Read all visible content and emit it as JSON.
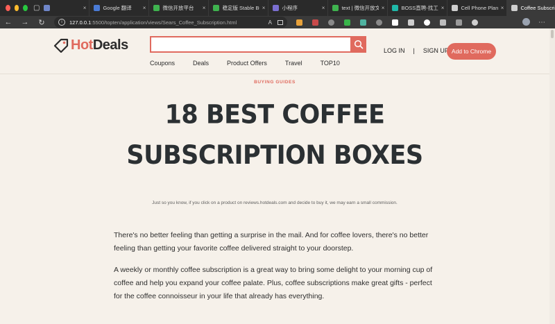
{
  "browser": {
    "tabs": [
      {
        "label": "",
        "color": "#6f86c9"
      },
      {
        "label": "Google 翻译",
        "color": "#4a7bd6"
      },
      {
        "label": "微信开放平台",
        "color": "#3fb34f"
      },
      {
        "label": "稳定版 Stable Bu",
        "color": "#3fb34f"
      },
      {
        "label": "小程序",
        "color": "#7b6fd1"
      },
      {
        "label": "text | 微信开放文",
        "color": "#3fb34f"
      },
      {
        "label": "BOSS直聘-找工作",
        "color": "#1fb8a8"
      },
      {
        "label": "Cell Phone Plans",
        "color": "#cfcfcf"
      },
      {
        "label": "Coffee Subscript",
        "color": "#cfcfcf",
        "active": true
      }
    ],
    "url_host": "127.0.0.1",
    "url_path": ":5500/topten/application/views/Sears_Coffee_Subscription.html",
    "extension_colors": [
      "#e8a23b",
      "#c94a4a",
      "#8a8a8a",
      "#39b54a",
      "#4fb3a0",
      "#8a8a8a",
      "#ffffff",
      "#cfcfcf",
      "#ffffff",
      "#bdbdbd",
      "#9b9b9b",
      "#d0d0d0"
    ]
  },
  "site": {
    "logo_hot": "Hot",
    "logo_deals": "Deals",
    "search_placeholder": "",
    "nav": [
      "Coupons",
      "Deals",
      "Product Offers",
      "Travel",
      "TOP10"
    ],
    "login": "LOG IN",
    "separator": "|",
    "signup": "SIGN UP",
    "cta": "Add to Chrome",
    "accent": "#e06a5e"
  },
  "article": {
    "eyebrow": "BUYING GUIDES",
    "headline_line1": "18 BEST COFFEE",
    "headline_line2": "SUBSCRIPTION BOXES",
    "disclosure": "Just so you know, if you click on a product on reviews.hotdeals.com and decide to buy it, we may earn a small commission.",
    "paragraph1": "There's no better feeling than getting a surprise in the mail. And for coffee lovers, there's no better feeling than getting your favorite coffee delivered straight to your doorstep.",
    "paragraph2": "A weekly or monthly coffee subscription is a great way to bring some delight to your morning cup of coffee and help you expand your coffee palate. Plus, coffee subscriptions make great gifts - perfect for the coffee connoisseur in your life that already has everything."
  }
}
